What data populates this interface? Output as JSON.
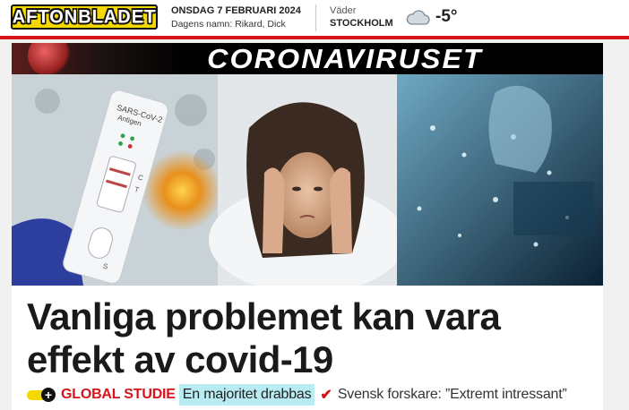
{
  "header": {
    "logo_text": "AFTONBLADET",
    "date": "ONSDAG 7 FEBRUARI 2024",
    "namedays": "Dagens namn: Rikard, Dick",
    "weather_label": "Väder",
    "weather_city": "STOCKHOLM",
    "weather_icon": "cloud-icon",
    "temperature": "-5°"
  },
  "article": {
    "banner": "CORONAVIRUSET",
    "image_description_icon": "hero-image",
    "test_label_1": "SARS-CoV-2",
    "test_label_2": "Antigen",
    "headline": "Vanliga problemet kan vara effekt av covid-19",
    "kicker": "GLOBAL STUDIE",
    "highlight": "En majoritet drabbas",
    "rest": "Svensk forskare: ”Extremt intressant”"
  },
  "colors": {
    "brand_yellow": "#f4d800",
    "accent_red": "#d6141a",
    "highlight": "#b9ecf2"
  }
}
